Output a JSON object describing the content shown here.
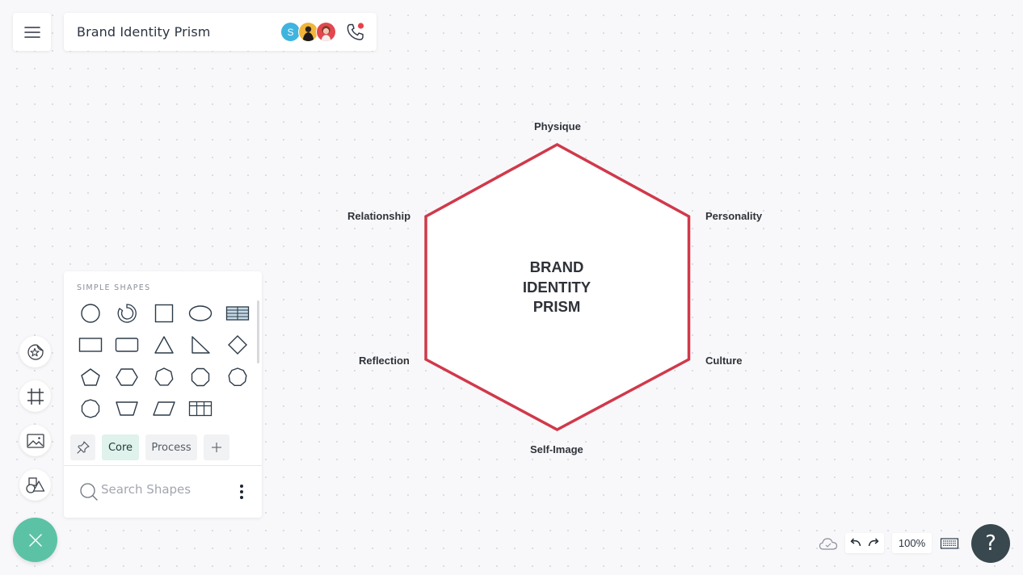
{
  "header": {
    "menu_icon": "hamburger-icon",
    "title": "Brand Identity Prism",
    "collaborators": [
      {
        "initial": "S",
        "color": "#3fb4df",
        "kind": "initial"
      },
      {
        "initial": "",
        "color": "#f1b53a",
        "kind": "photo"
      },
      {
        "initial": "",
        "color": "#e4474f",
        "kind": "photo"
      }
    ],
    "call_icon": "phone-icon",
    "call_indicator_color": "#e8414a"
  },
  "left_toolbar": {
    "items": [
      {
        "name": "favorites",
        "icon": "star-sticker-icon"
      },
      {
        "name": "frame",
        "icon": "frame-grid-icon"
      },
      {
        "name": "image",
        "icon": "image-icon"
      },
      {
        "name": "shapes",
        "icon": "shapes-icon"
      }
    ],
    "close_button_color": "#5cc2a6"
  },
  "shapes_panel": {
    "heading": "SIMPLE SHAPES",
    "shapes": [
      "circle",
      "partial-circle",
      "square",
      "ellipse",
      "table-shaded",
      "rectangle",
      "rounded-rectangle",
      "triangle",
      "right-triangle",
      "diamond",
      "pentagon",
      "hexagon",
      "heptagon",
      "octagon",
      "nonagon",
      "decagon",
      "trapezoid",
      "parallelogram",
      "table"
    ],
    "tabs": [
      {
        "label": "",
        "icon": "pin-icon",
        "active": false
      },
      {
        "label": "Core",
        "active": true
      },
      {
        "label": "Process",
        "active": false
      },
      {
        "label": "",
        "icon": "plus-icon",
        "active": false
      }
    ],
    "search": {
      "placeholder": "Search Shapes",
      "value": ""
    },
    "more_icon": "more-vertical-icon"
  },
  "diagram": {
    "center_title": "BRAND\nIDENTITY\nPRISM",
    "stroke_color": "#d0394a",
    "facets": {
      "top": "Physique",
      "top_right": "Personality",
      "bottom_right": "Culture",
      "bottom": "Self-Image",
      "bottom_left": "Reflection",
      "top_left": "Relationship"
    }
  },
  "bottom_bar": {
    "save_status_icon": "cloud-check-icon",
    "undo_icon": "undo-icon",
    "redo_icon": "redo-icon",
    "zoom_level": "100%",
    "keyboard_icon": "keyboard-icon",
    "help_label": "?"
  }
}
